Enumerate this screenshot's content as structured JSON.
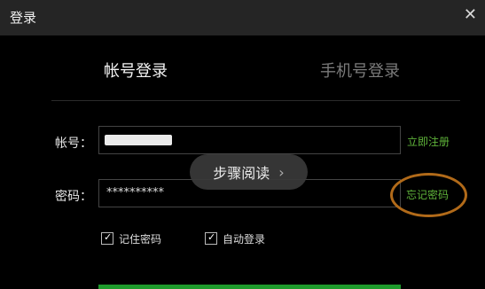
{
  "window": {
    "title": "登录",
    "close_symbol": "✕"
  },
  "tabs": [
    {
      "label": "帐号登录",
      "active": true
    },
    {
      "label": "手机号登录",
      "active": false
    }
  ],
  "form": {
    "account_label": "帐号：",
    "account_value": "",
    "password_label": "密码：",
    "password_value": "**********",
    "register_link": "立即注册",
    "forgot_link": "忘记密码"
  },
  "options": {
    "remember_label": "记住密码",
    "remember_checked": true,
    "auto_login_label": "自动登录",
    "auto_login_checked": true,
    "checkmark": "✓"
  },
  "overlay": {
    "label": "步骤阅读",
    "arrow": "›"
  },
  "colors": {
    "accent_green": "#5fb33a",
    "button_green": "#1e9b2c",
    "annotation_orange": "#b16a19",
    "titlebar": "#252525",
    "background": "#000000"
  }
}
